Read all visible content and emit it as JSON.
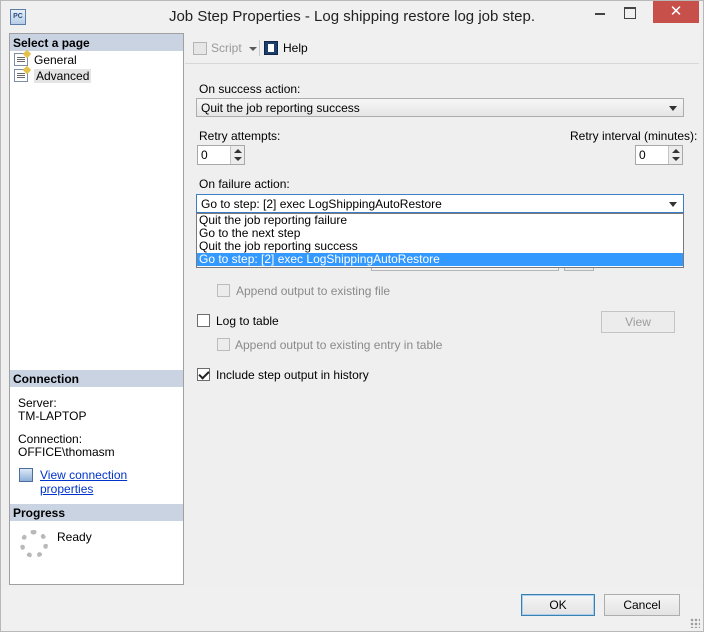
{
  "window": {
    "title": "Job Step Properties - Log shipping restore log job step.",
    "app_icon_text": "PC",
    "close_glyph": "✕"
  },
  "left": {
    "select_page_header": "Select a page",
    "pages": [
      {
        "label": "General"
      },
      {
        "label": "Advanced"
      }
    ],
    "connection_header": "Connection",
    "server_label": "Server:",
    "server_value": "TM-LAPTOP",
    "connection_label": "Connection:",
    "connection_value": "OFFICE\\thomasm",
    "view_connection_link": "View connection properties",
    "progress_header": "Progress",
    "progress_status": "Ready"
  },
  "toolbar": {
    "script_label": "Script",
    "help_label": "Help"
  },
  "form": {
    "on_success_label": "On success action:",
    "on_success_value": "Quit the job reporting success",
    "retry_attempts_label": "Retry attempts:",
    "retry_attempts_value": "0",
    "retry_interval_label": "Retry interval (minutes):",
    "retry_interval_value": "0",
    "on_failure_label": "On failure action:",
    "on_failure_value": "Go to step: [2] exec LogShippingAutoRestore",
    "failure_options": [
      "Quit the job reporting failure",
      "Go to the next step",
      "Quit the job reporting success",
      "Go to step: [2] exec LogShippingAutoRestore"
    ],
    "append_output_file_label": "Append output to existing file",
    "log_to_table_label": "Log to table",
    "view_button": "View",
    "append_output_table_label": "Append output to existing entry in table",
    "include_history_label": "Include step output in history"
  },
  "footer": {
    "ok_label": "OK",
    "cancel_label": "Cancel"
  }
}
